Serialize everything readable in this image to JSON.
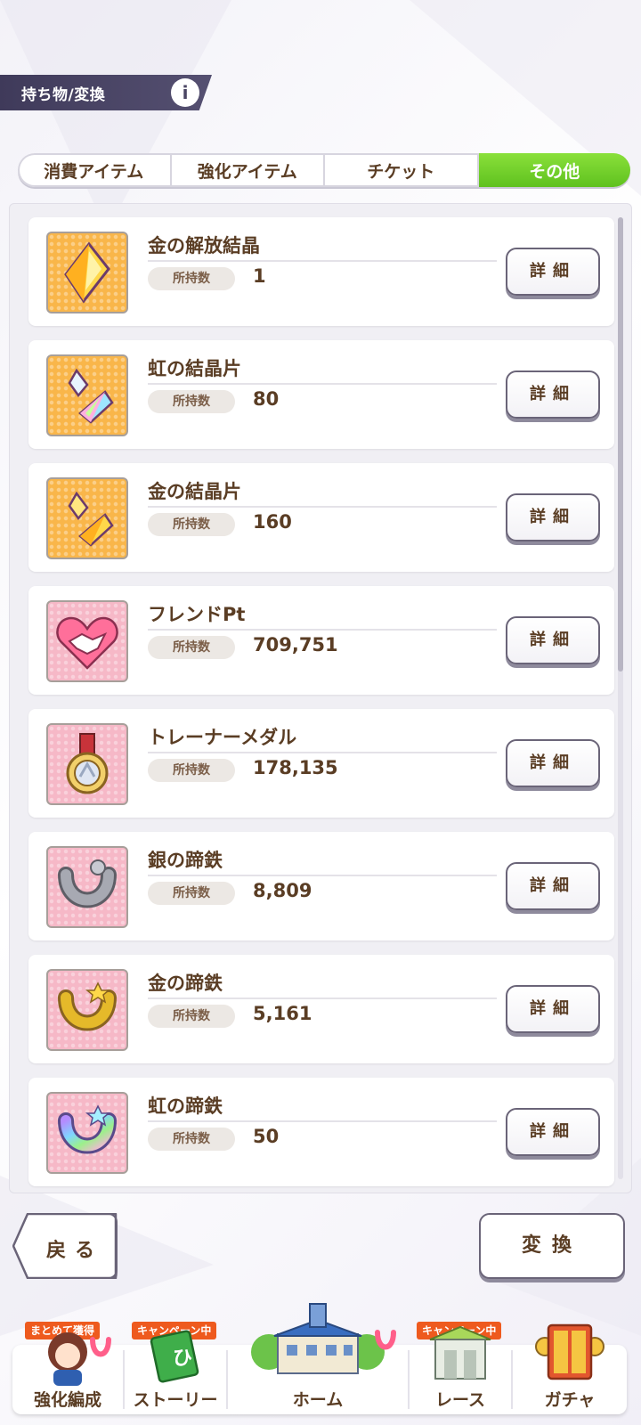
{
  "header": {
    "title": "持ち物/変換",
    "info_icon": "info-icon"
  },
  "tabs": [
    {
      "label": "消費アイテム",
      "active": false
    },
    {
      "label": "強化アイテム",
      "active": false
    },
    {
      "label": "チケット",
      "active": false
    },
    {
      "label": "その他",
      "active": true
    }
  ],
  "colors": {
    "active_tab": "#6fd02a",
    "tile_orange": "#f9b64a",
    "tile_pink": "#f6b8c7",
    "text_brown": "#5a3d24",
    "badge_orange": "#ee5a1e"
  },
  "items": [
    {
      "name": "金の解放結晶",
      "owned_label": "所持数",
      "count": "1",
      "detail": "詳細",
      "icon": "gold-release-crystal-icon"
    },
    {
      "name": "虹の結晶片",
      "owned_label": "所持数",
      "count": "80",
      "detail": "詳細",
      "icon": "rainbow-crystal-shard-icon"
    },
    {
      "name": "金の結晶片",
      "owned_label": "所持数",
      "count": "160",
      "detail": "詳細",
      "icon": "gold-crystal-shard-icon"
    },
    {
      "name": "フレンドPt",
      "owned_label": "所持数",
      "count": "709,751",
      "detail": "詳細",
      "icon": "friend-points-handshake-icon"
    },
    {
      "name": "トレーナーメダル",
      "owned_label": "所持数",
      "count": "178,135",
      "detail": "詳細",
      "icon": "trainer-medal-icon"
    },
    {
      "name": "銀の蹄鉄",
      "owned_label": "所持数",
      "count": "8,809",
      "detail": "詳細",
      "icon": "silver-horseshoe-icon"
    },
    {
      "name": "金の蹄鉄",
      "owned_label": "所持数",
      "count": "5,161",
      "detail": "詳細",
      "icon": "gold-horseshoe-icon"
    },
    {
      "name": "虹の蹄鉄",
      "owned_label": "所持数",
      "count": "50",
      "detail": "詳細",
      "icon": "rainbow-horseshoe-icon"
    }
  ],
  "actions": {
    "back": "戻る",
    "convert": "変換"
  },
  "nav": [
    {
      "label": "強化編成",
      "badge": "まとめて獲得"
    },
    {
      "label": "ストーリー",
      "badge": "キャンペーン中"
    },
    {
      "label": "ホーム",
      "badge": ""
    },
    {
      "label": "レース",
      "badge": "キャンペーン中"
    },
    {
      "label": "ガチャ",
      "badge": ""
    }
  ]
}
